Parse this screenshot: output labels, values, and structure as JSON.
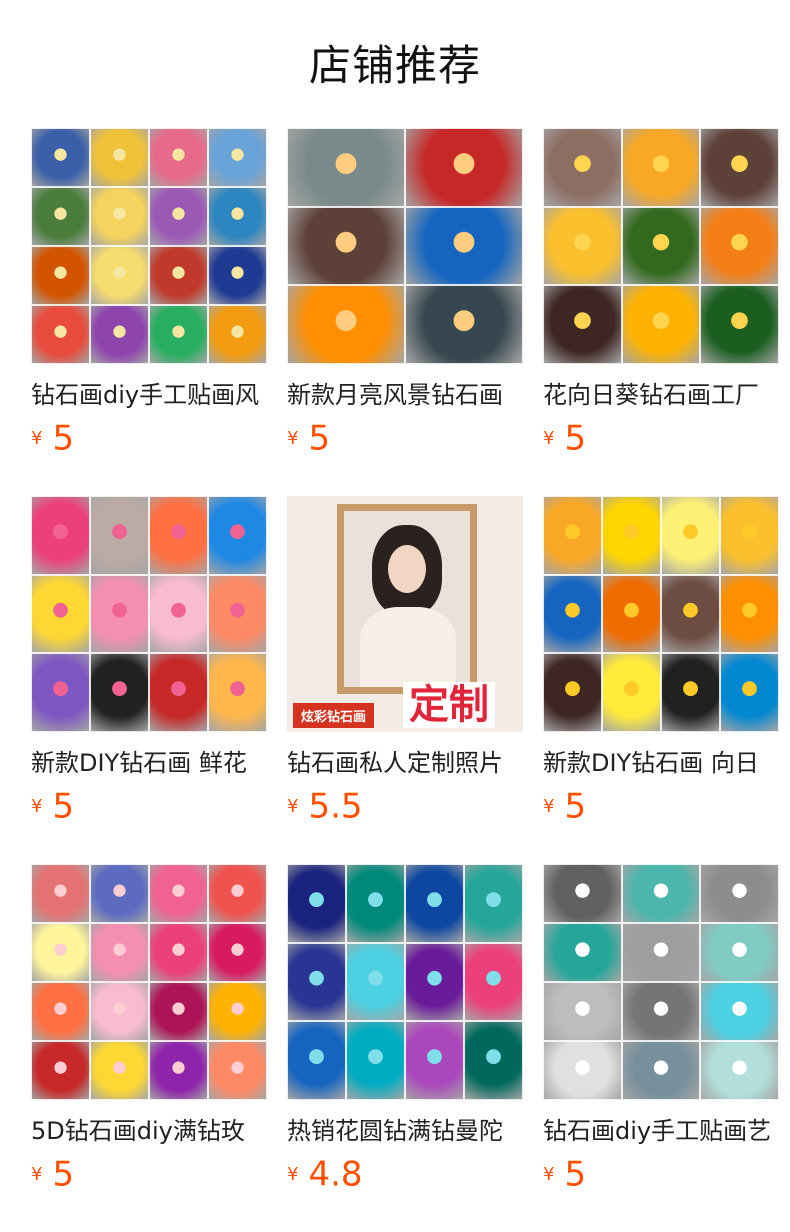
{
  "header": {
    "title": "店铺推荐"
  },
  "currency_symbol": "¥",
  "products": [
    {
      "title": "钻石画diy手工贴画风",
      "price": "5",
      "image": {
        "kind": "grid",
        "cols": 4,
        "rows": 4,
        "colors": [
          "#3b5fa8",
          "#f0c23a",
          "#e86a8a",
          "#6aa3d8",
          "#4a7c3c",
          "#f4d35e",
          "#9b59b6",
          "#2e86c1",
          "#d35400",
          "#f7dc6f",
          "#c0392b",
          "#1f3a93",
          "#e74c3c",
          "#8e44ad",
          "#27ae60",
          "#f39c12"
        ],
        "accent": "#f5e7a1"
      }
    },
    {
      "title": "新款月亮风景钻石画",
      "price": "5",
      "image": {
        "kind": "grid",
        "cols": 2,
        "rows": 3,
        "colors": [
          "#7a8a8a",
          "#c62828",
          "#5d4037",
          "#1565c0",
          "#ff8f00",
          "#37474f"
        ],
        "accent": "#ffcc80"
      }
    },
    {
      "title": "花向日葵钻石画工厂",
      "price": "5",
      "image": {
        "kind": "grid",
        "cols": 3,
        "rows": 3,
        "colors": [
          "#8d6e63",
          "#f9a825",
          "#5d4037",
          "#fbc02d",
          "#33691e",
          "#f57f17",
          "#3e2723",
          "#ffb300",
          "#1b5e20"
        ],
        "accent": "#ffd54f"
      }
    },
    {
      "title": "新款DIY钻石画 鲜花",
      "price": "5",
      "image": {
        "kind": "grid",
        "cols": 4,
        "rows": 3,
        "colors": [
          "#ec407a",
          "#bcaaa4",
          "#ff7043",
          "#1e88e5",
          "#fdd835",
          "#f48fb1",
          "#f8bbd0",
          "#ff8a65",
          "#7e57c2",
          "#212121",
          "#c62828",
          "#ffb74d"
        ],
        "accent": "#f06292"
      }
    },
    {
      "title": "钻石画私人定制照片",
      "price": "5.5",
      "image": {
        "kind": "portrait",
        "colors": [
          "#f3ece6",
          "#c89a6a",
          "#2b2220",
          "#f5efe8"
        ],
        "badge_left": "炫彩钻石画",
        "badge_right": "定制"
      }
    },
    {
      "title": "新款DIY钻石画 向日",
      "price": "5",
      "image": {
        "kind": "grid",
        "cols": 4,
        "rows": 3,
        "colors": [
          "#f9a825",
          "#ffd600",
          "#fff176",
          "#fbc02d",
          "#1565c0",
          "#ef6c00",
          "#6d4c41",
          "#ff8f00",
          "#3e2723",
          "#ffeb3b",
          "#212121",
          "#0288d1"
        ],
        "accent": "#ffca28"
      }
    },
    {
      "title": "5D钻石画diy满钻玫",
      "price": "5",
      "image": {
        "kind": "grid",
        "cols": 4,
        "rows": 4,
        "colors": [
          "#e57373",
          "#5c6bc0",
          "#f06292",
          "#ef5350",
          "#fff59d",
          "#f48fb1",
          "#ec407a",
          "#d81b60",
          "#ff7043",
          "#f8bbd0",
          "#ad1457",
          "#ffb300",
          "#c62828",
          "#fdd835",
          "#8e24aa",
          "#ff8a65"
        ],
        "accent": "#ffcdd2"
      }
    },
    {
      "title": "热销花圆钻满钻曼陀",
      "price": "4.8",
      "image": {
        "kind": "grid",
        "cols": 4,
        "rows": 3,
        "colors": [
          "#1a237e",
          "#00897b",
          "#0d47a1",
          "#26a69a",
          "#283593",
          "#4dd0e1",
          "#6a1b9a",
          "#ec407a",
          "#1565c0",
          "#00acc1",
          "#ab47bc",
          "#00695c"
        ],
        "accent": "#80deea"
      }
    },
    {
      "title": "钻石画diy手工贴画艺",
      "price": "5",
      "image": {
        "kind": "grid",
        "cols": 3,
        "rows": 4,
        "colors": [
          "#616161",
          "#4db6ac",
          "#8d8d8d",
          "#26a69a",
          "#9e9e9e",
          "#80cbc4",
          "#bdbdbd",
          "#757575",
          "#4dd0e1",
          "#e0e0e0",
          "#78909c",
          "#b2dfdb"
        ],
        "accent": "#ffffff"
      }
    }
  ]
}
